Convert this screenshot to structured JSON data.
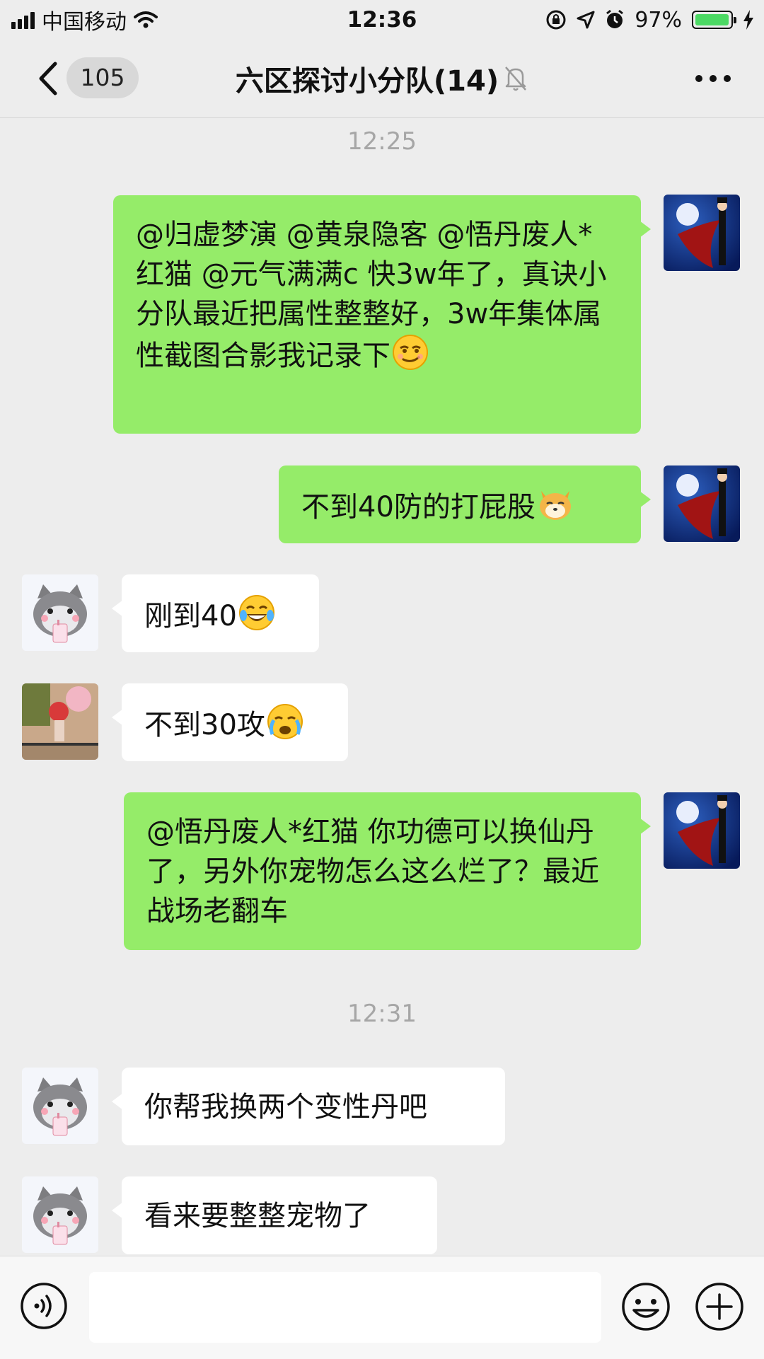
{
  "status_bar": {
    "carrier": "中国移动",
    "time": "12:36",
    "battery_percent": "97%",
    "battery_level": 0.97
  },
  "nav": {
    "unread_count": "105",
    "title": "六区探讨小分队(14)"
  },
  "chat": {
    "timestamps": [
      "12:25",
      "12:31"
    ],
    "messages": [
      {
        "from": "me",
        "text": "@归虚梦演 @黄泉隐客 @悟丹废人*红猫 @元气满满c 快3w年了，真诀小分队最近把属性整整好，3w年集体属性截图合影我记录下",
        "emoji": "smirk-emoji"
      },
      {
        "from": "me",
        "text": "不到40防的打屁股",
        "emoji": "shiba-emoji"
      },
      {
        "from": "cat-user",
        "text": "刚到40",
        "emoji": "tears-of-joy-emoji"
      },
      {
        "from": "red-user",
        "text": "不到30攻",
        "emoji": "crying-emoji"
      },
      {
        "from": "me",
        "text": "@悟丹废人*红猫 你功德可以换仙丹了，另外你宠物怎么这么烂了？最近战场老翻车"
      },
      {
        "from": "cat-user",
        "text": "你帮我换两个变性丹吧"
      },
      {
        "from": "cat-user",
        "text": "看来要整整宠物了"
      }
    ]
  },
  "input": {
    "placeholder": ""
  },
  "colors": {
    "background": "#ededed",
    "mine_bubble": "#95ec69",
    "theirs_bubble": "#ffffff",
    "timestamp": "#a6a6a6",
    "battery": "#4cd964"
  },
  "icons": [
    "signal-icon",
    "wifi-icon",
    "lock-rotation-icon",
    "location-icon",
    "alarm-icon",
    "battery-icon",
    "charging-icon",
    "back-icon",
    "mute-bell-icon",
    "more-icon",
    "voice-icon",
    "emoji-icon",
    "plus-icon"
  ]
}
